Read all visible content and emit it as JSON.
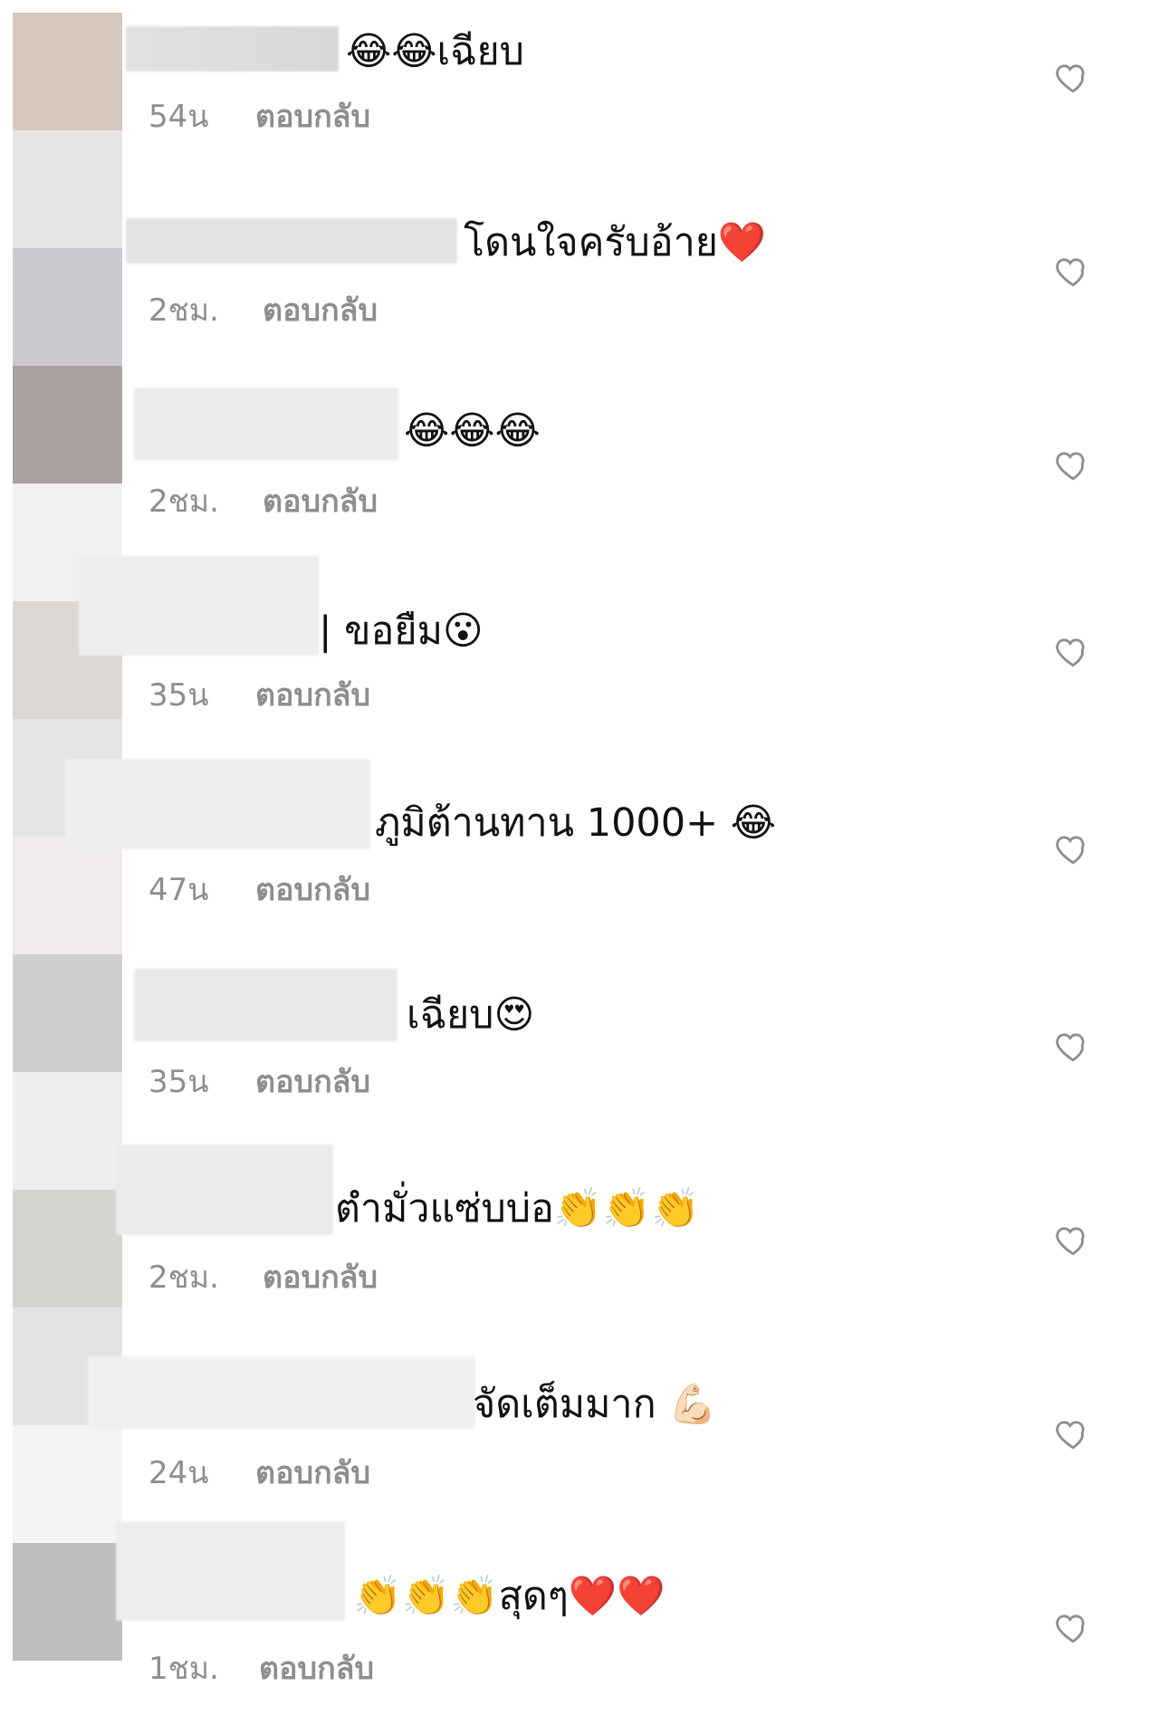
{
  "comments": [
    {
      "text": "😂😂เฉียบ",
      "time": "54น",
      "reply": "ตอบกลับ"
    },
    {
      "text": "โดนใจครับอ้าย❤️",
      "time": "2ชม.",
      "reply": "ตอบกลับ"
    },
    {
      "text": "😂😂😂",
      "time": "2ชม.",
      "reply": "ตอบกลับ"
    },
    {
      "text": "| ขอยืม😮",
      "time": "35น",
      "reply": "ตอบกลับ"
    },
    {
      "text": "ภูมิต้านทาน 1000+ 😂",
      "time": "47น",
      "reply": "ตอบกลับ"
    },
    {
      "text": "เฉียบ😍",
      "time": "35น",
      "reply": "ตอบกลับ"
    },
    {
      "text": "ตำมั่วแซ่บบ่อ👏👏👏",
      "time": "2ชม.",
      "reply": "ตอบกลับ"
    },
    {
      "text": "จัดเต็มมาก 💪🏻",
      "time": "24น",
      "reply": "ตอบกลับ"
    },
    {
      "text": "👏👏👏สุดๆ❤️❤️",
      "time": "1ชม.",
      "reply": "ตอบกลับ"
    }
  ],
  "icons": {
    "like": "heart-outline-icon"
  },
  "colors": {
    "text": "#111111",
    "meta": "#8e8e8e",
    "heart": "#8e8e8e"
  }
}
